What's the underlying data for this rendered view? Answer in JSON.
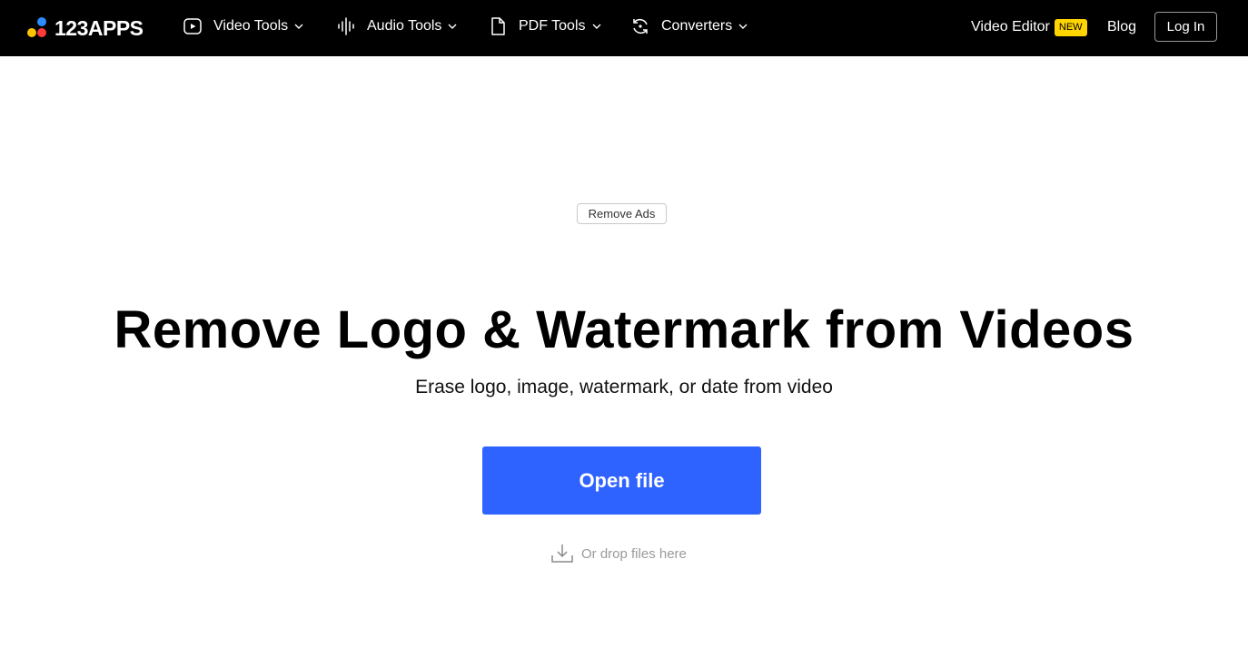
{
  "brand": {
    "logo_text": "123APPS",
    "dot_colors": [
      "#2d8cff",
      "#ffc400",
      "#ff3b3b"
    ]
  },
  "nav": {
    "items": [
      {
        "label": "Video Tools",
        "icon": "play-icon"
      },
      {
        "label": "Audio Tools",
        "icon": "waveform-icon"
      },
      {
        "label": "PDF Tools",
        "icon": "document-icon"
      },
      {
        "label": "Converters",
        "icon": "refresh-icon"
      }
    ],
    "video_editor_label": "Video Editor",
    "new_badge": "NEW",
    "blog_label": "Blog",
    "login_label": "Log In"
  },
  "main": {
    "remove_ads_label": "Remove Ads",
    "title": "Remove Logo & Watermark from Videos",
    "subtitle": "Erase logo, image, watermark, or date from video",
    "open_file_label": "Open file",
    "drop_text": "Or drop files here"
  },
  "colors": {
    "topbar_bg": "#000000",
    "accent": "#2f63ff",
    "badge": "#ffd400"
  }
}
